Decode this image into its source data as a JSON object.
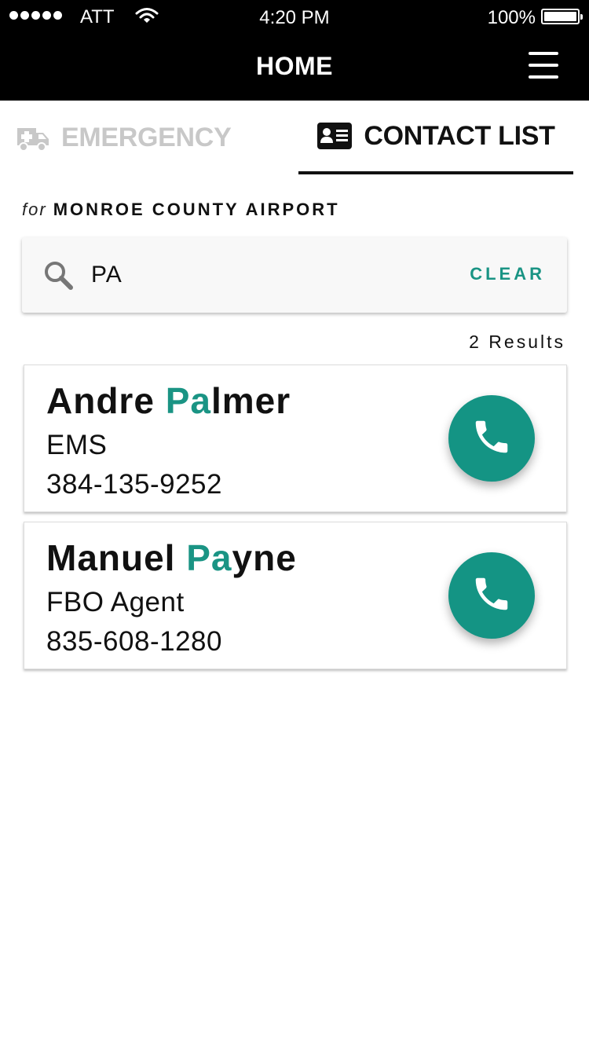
{
  "status_bar": {
    "carrier": "ATT",
    "time": "4:20 PM",
    "battery": "100%"
  },
  "nav": {
    "title": "HOME",
    "menu_icon": "hamburger-menu-icon"
  },
  "tabs": [
    {
      "label": "EMERGENCY",
      "icon": "ambulance-icon",
      "active": false
    },
    {
      "label": "CONTACT LIST",
      "icon": "contact-card-icon",
      "active": true
    }
  ],
  "airport": {
    "prefix": "for",
    "name": "MONROE COUNTY AIRPORT"
  },
  "search": {
    "value": "PA",
    "clear_label": "CLEAR",
    "icon": "search-icon"
  },
  "results_count": "2 Results",
  "contacts": [
    {
      "name_before": "Andre ",
      "name_match": "Pa",
      "name_after": "lmer",
      "role": "EMS",
      "phone": "384-135-9252"
    },
    {
      "name_before": "Manuel ",
      "name_match": "Pa",
      "name_after": "yne",
      "role": "FBO Agent",
      "phone": "835-608-1280"
    }
  ],
  "colors": {
    "accent": "#1a9484",
    "header_bg": "#000000",
    "inactive_tab": "#c8c8c8"
  }
}
